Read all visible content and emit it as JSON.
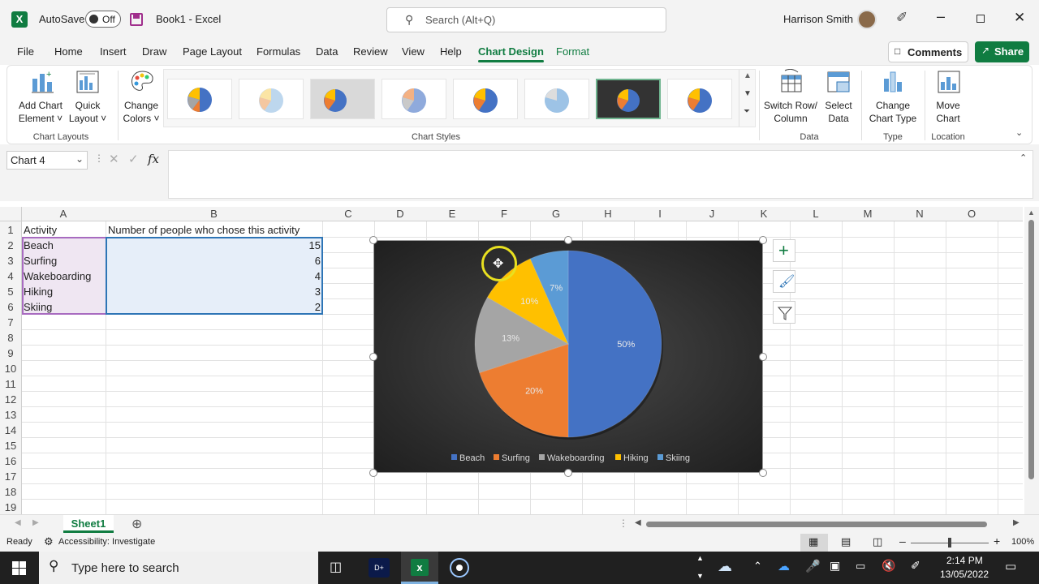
{
  "titlebar": {
    "autosave_label": "AutoSave",
    "autosave_state": "Off",
    "doc_title": "Book1  -  Excel",
    "search_placeholder": "Search (Alt+Q)",
    "user_name": "Harrison Smith"
  },
  "tabs": [
    "File",
    "Home",
    "Insert",
    "Draw",
    "Page Layout",
    "Formulas",
    "Data",
    "Review",
    "View",
    "Help",
    "Chart Design",
    "Format"
  ],
  "active_tab": "Chart Design",
  "buttons": {
    "comments": "Comments",
    "share": "Share"
  },
  "ribbon": {
    "add_chart_element": [
      "Add Chart",
      "Element ˅"
    ],
    "quick_layout": [
      "Quick",
      "Layout ˅"
    ],
    "change_colors": [
      "Change",
      "Colors ˅"
    ],
    "switch_row_col": [
      "Switch Row/",
      "Column"
    ],
    "select_data": [
      "Select",
      "Data"
    ],
    "change_chart_type": [
      "Change",
      "Chart Type"
    ],
    "move_chart": [
      "Move",
      "Chart"
    ],
    "groups": {
      "chart_layouts": "Chart Layouts",
      "chart_styles": "Chart Styles",
      "data": "Data",
      "type": "Type",
      "location": "Location"
    }
  },
  "formula_bar": {
    "name_box": "Chart 4",
    "fx": "fx",
    "value": ""
  },
  "columns": [
    "A",
    "B",
    "C",
    "D",
    "E",
    "F",
    "G",
    "H",
    "I",
    "J",
    "K",
    "L",
    "M",
    "N",
    "O"
  ],
  "rows": [
    "1",
    "2",
    "3",
    "4",
    "5",
    "6",
    "7",
    "8",
    "9",
    "10",
    "11",
    "12",
    "13",
    "14",
    "15",
    "16",
    "17",
    "18",
    "19"
  ],
  "sheet": {
    "header": [
      "Activity",
      "Number of people who chose this activity"
    ],
    "data": [
      [
        "Beach",
        "15"
      ],
      [
        "Surfing",
        "6"
      ],
      [
        "Wakeboarding",
        "4"
      ],
      [
        "Hiking",
        "3"
      ],
      [
        "Skiing",
        "2"
      ]
    ]
  },
  "chart_data": {
    "type": "pie",
    "title": "",
    "categories": [
      "Beach",
      "Surfing",
      "Wakeboarding",
      "Hiking",
      "Skiing"
    ],
    "values": [
      15,
      6,
      4,
      3,
      2
    ],
    "data_labels": [
      "50%",
      "20%",
      "13%",
      "10%",
      "7%"
    ],
    "colors": [
      "#4472c4",
      "#ed7d31",
      "#a5a5a5",
      "#ffc000",
      "#5b9bd5"
    ],
    "background": "#2e2e2e",
    "legend_position": "bottom"
  },
  "sheet_tabs": [
    "Sheet1"
  ],
  "status": {
    "ready": "Ready",
    "accessibility": "Accessibility: Investigate",
    "zoom": "100%"
  },
  "taskbar": {
    "search_placeholder": "Type here to search",
    "time": "2:14 PM",
    "date": "13/05/2022"
  },
  "colors": {
    "excel_green": "#107c41",
    "accent_selection": "#217346"
  }
}
